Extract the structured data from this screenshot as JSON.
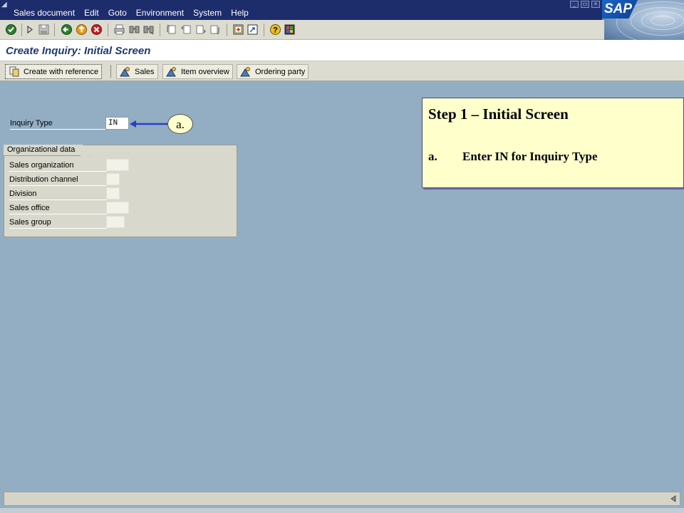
{
  "menubar": {
    "items": [
      "Sales document",
      "Edit",
      "Goto",
      "Environment",
      "System",
      "Help"
    ],
    "logo_text": "SAP"
  },
  "toolbar": {
    "icons": [
      "enter-icon",
      "command-field-icon",
      "save-icon",
      "back-icon",
      "exit-icon",
      "cancel-icon",
      "print-icon",
      "find-icon",
      "find-next-icon",
      "first-page-icon",
      "previous-page-icon",
      "next-page-icon",
      "last-page-icon",
      "create-session-icon",
      "shortcut-icon",
      "help-icon",
      "layout-icon"
    ]
  },
  "title": {
    "text": "Create Inquiry: Initial Screen"
  },
  "app_toolbar": {
    "create_with_reference": "Create with reference",
    "sales": "Sales",
    "item_overview": "Item overview",
    "ordering_party": "Ordering party"
  },
  "form": {
    "inquiry_type_label": "Inquiry Type",
    "inquiry_type_value": "IN"
  },
  "callout": {
    "label": "a."
  },
  "org_data": {
    "tab_label": "Organizational data",
    "rows": [
      {
        "label": "Sales organization",
        "value": ""
      },
      {
        "label": "Distribution channel",
        "value": ""
      },
      {
        "label": "Division",
        "value": ""
      },
      {
        "label": "Sales office",
        "value": ""
      },
      {
        "label": "Sales group",
        "value": ""
      }
    ]
  },
  "instructions": {
    "heading": "Step 1 – Initial Screen",
    "steps": [
      {
        "marker": "a.",
        "text": "Enter IN for Inquiry Type"
      }
    ]
  },
  "colors": {
    "menubar": "#1d2c6b",
    "background": "#93aec3",
    "title_text": "#1f3a6e",
    "callout_fill": "#ffffcc",
    "arrow": "#2a3fc4"
  }
}
